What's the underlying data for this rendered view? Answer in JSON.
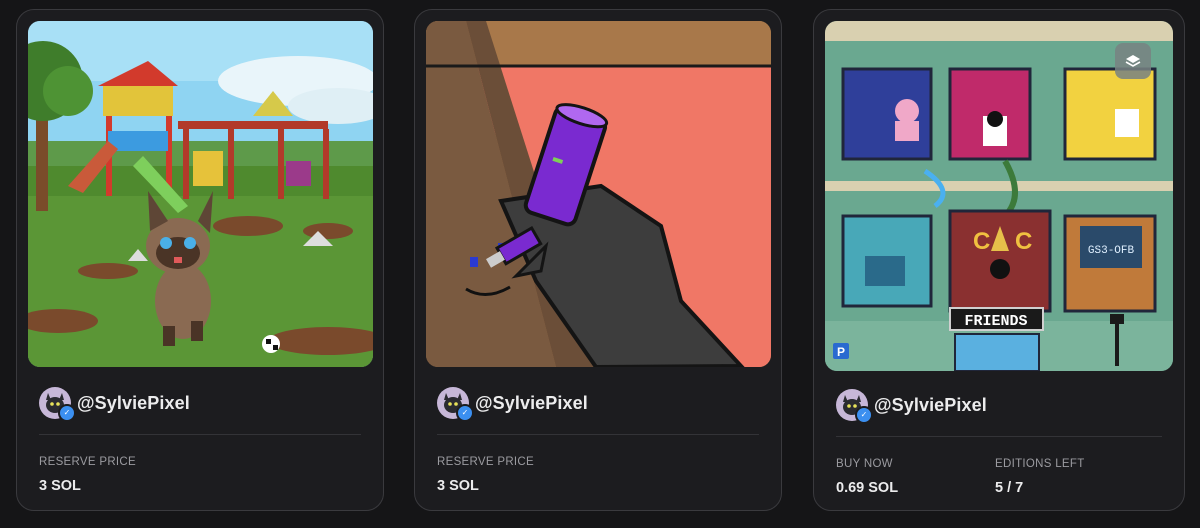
{
  "cards": [
    {
      "creator": "@SylviePixel",
      "stats": [
        {
          "label": "RESERVE PRICE",
          "value": "3 SOL"
        }
      ]
    },
    {
      "creator": "@SylviePixel",
      "stats": [
        {
          "label": "RESERVE PRICE",
          "value": "3 SOL"
        }
      ]
    },
    {
      "creator": "@SylviePixel",
      "art_sign": "FRIENDS",
      "art_screen": "GS3-OFB",
      "stats": [
        {
          "label": "BUY NOW",
          "value": "0.69 SOL"
        },
        {
          "label": "EDITIONS LEFT",
          "value": "5 / 7"
        }
      ]
    }
  ],
  "icons": {
    "verified": "verified-check-icon",
    "layers": "layers-icon"
  },
  "colors": {
    "page_bg": "#151517",
    "card_bg": "#1c1c1f",
    "verified_blue": "#3b8ff0"
  }
}
